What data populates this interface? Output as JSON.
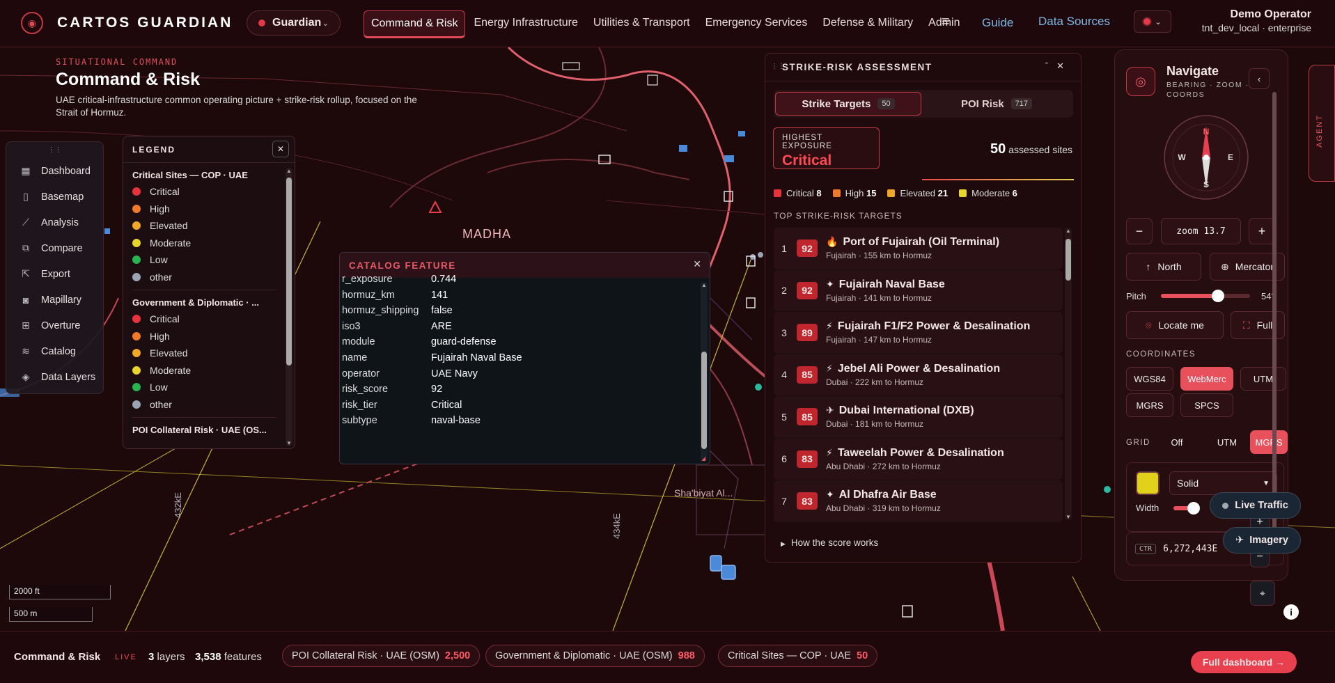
{
  "app": {
    "brand": "CARTOS GUARDIAN",
    "role": "Guardian"
  },
  "nav": {
    "items": [
      "Command & Risk",
      "Energy Infrastructure",
      "Utilities & Transport",
      "Emergency Services",
      "Defense & Military",
      "Admin"
    ],
    "guide": "Guide",
    "data_sources": "Data Sources"
  },
  "user": {
    "name": "Demo Operator",
    "sub": "tnt_dev_local · enterprise"
  },
  "page": {
    "kicker": "SITUATIONAL COMMAND",
    "title": "Command & Risk",
    "desc": "UAE critical-infrastructure common operating picture + strike-risk rollup, focused on the Strait of Hormuz."
  },
  "toolbox": {
    "items": [
      {
        "label": "Dashboard",
        "icon": "grid-icon"
      },
      {
        "label": "Basemap",
        "icon": "map-icon"
      },
      {
        "label": "Analysis",
        "icon": "chart-icon"
      },
      {
        "label": "Compare",
        "icon": "compare-icon"
      },
      {
        "label": "Export",
        "icon": "export-icon"
      },
      {
        "label": "Mapillary",
        "icon": "camera-icon"
      },
      {
        "label": "Overture",
        "icon": "table-icon"
      },
      {
        "label": "Catalog",
        "icon": "layers-icon"
      },
      {
        "label": "Data Layers",
        "icon": "stack-icon"
      }
    ]
  },
  "legend": {
    "title": "LEGEND",
    "sections": [
      {
        "title": "Critical Sites — COP · UAE",
        "rows": [
          {
            "label": "Critical",
            "color": "#e8323c"
          },
          {
            "label": "High",
            "color": "#f07a2a"
          },
          {
            "label": "Elevated",
            "color": "#f0a628"
          },
          {
            "label": "Moderate",
            "color": "#e8d42a"
          },
          {
            "label": "Low",
            "color": "#28b450"
          },
          {
            "label": "other",
            "color": "#9aa4b4"
          }
        ]
      },
      {
        "title": "Government & Diplomatic · ...",
        "rows": [
          {
            "label": "Critical",
            "color": "#e8323c"
          },
          {
            "label": "High",
            "color": "#f07a2a"
          },
          {
            "label": "Elevated",
            "color": "#f0a628"
          },
          {
            "label": "Moderate",
            "color": "#e8d42a"
          },
          {
            "label": "Low",
            "color": "#28b450"
          },
          {
            "label": "other",
            "color": "#9aa4b4"
          }
        ]
      },
      {
        "title": "POI Collateral Risk · UAE (OS...",
        "rows": []
      }
    ]
  },
  "catalog": {
    "title": "CATALOG FEATURE",
    "rows": [
      {
        "k": "r_exposure",
        "v": "0.744"
      },
      {
        "k": "hormuz_km",
        "v": "141"
      },
      {
        "k": "hormuz_shipping",
        "v": "false"
      },
      {
        "k": "iso3",
        "v": "ARE"
      },
      {
        "k": "module",
        "v": "guard-defense"
      },
      {
        "k": "name",
        "v": "Fujairah Naval Base"
      },
      {
        "k": "operator",
        "v": "UAE Navy"
      },
      {
        "k": "risk_score",
        "v": "92"
      },
      {
        "k": "risk_tier",
        "v": "Critical"
      },
      {
        "k": "subtype",
        "v": "naval-base"
      }
    ]
  },
  "strike": {
    "title": "STRIKE-RISK ASSESSMENT",
    "tab_targets": "Strike Targets",
    "tab_targets_count": "50",
    "tab_poi": "POI Risk",
    "tab_poi_count": "717",
    "highest_label": "HIGHEST EXPOSURE",
    "highest_value": "Critical",
    "assessed_count": "50",
    "assessed_label": "assessed sites",
    "tiers": [
      {
        "label": "Critical",
        "count": "8",
        "color": "#e8323c"
      },
      {
        "label": "High",
        "count": "15",
        "color": "#f07a2a"
      },
      {
        "label": "Elevated",
        "count": "21",
        "color": "#f0a628"
      },
      {
        "label": "Moderate",
        "count": "6",
        "color": "#e8d42a"
      }
    ],
    "top_label": "TOP STRIKE-RISK TARGETS",
    "targets": [
      {
        "rank": "1",
        "score": "92",
        "glyph": "🔥",
        "name": "Port of Fujairah (Oil Terminal)",
        "sub": "Fujairah · 155 km to Hormuz"
      },
      {
        "rank": "2",
        "score": "92",
        "glyph": "✦",
        "name": "Fujairah Naval Base",
        "sub": "Fujairah · 141 km to Hormuz"
      },
      {
        "rank": "3",
        "score": "89",
        "glyph": "⚡",
        "name": "Fujairah F1/F2 Power & Desalination",
        "sub": "Fujairah · 147 km to Hormuz"
      },
      {
        "rank": "4",
        "score": "85",
        "glyph": "⚡",
        "name": "Jebel Ali Power & Desalination",
        "sub": "Dubai · 222 km to Hormuz"
      },
      {
        "rank": "5",
        "score": "85",
        "glyph": "✈",
        "name": "Dubai International (DXB)",
        "sub": "Dubai · 181 km to Hormuz"
      },
      {
        "rank": "6",
        "score": "83",
        "glyph": "⚡",
        "name": "Taweelah Power & Desalination",
        "sub": "Abu Dhabi · 272 km to Hormuz"
      },
      {
        "rank": "7",
        "score": "83",
        "glyph": "✦",
        "name": "Al Dhafra Air Base",
        "sub": "Abu Dhabi · 319 km to Hormuz"
      }
    ],
    "how": "How the score works"
  },
  "navigate": {
    "title": "Navigate",
    "sub1": "BEARING · ZOOM ·",
    "sub2": "COORDS",
    "zoom": "zoom 13.7",
    "north": "North",
    "projection": "Mercator",
    "pitch_label": "Pitch",
    "pitch_value": "54°",
    "pitch_fraction": 0.64,
    "locate": "Locate me",
    "full": "Full",
    "coords_label": "COORDINATES",
    "coords": [
      "WGS84",
      "WebMerc",
      "UTM",
      "MGRS",
      "SPCS"
    ],
    "coords_selected": "WebMerc",
    "grid_label": "GRID",
    "grid": [
      "Off",
      "UTM",
      "MGRS"
    ],
    "grid_selected": "MGRS",
    "style": "Solid",
    "width_label": "Width",
    "swatch_color": "#e2d11a",
    "ctr_label": "CTR",
    "ctr_value": "6,272,443E",
    "agent": "AGENT",
    "compass": {
      "n": "N",
      "s": "S",
      "e": "E",
      "w": "W"
    }
  },
  "map": {
    "place": "MADHA",
    "place2": "Sha'biyat Al...",
    "grid1": "432kE",
    "grid2": "434kE",
    "scale_ft": "2000 ft",
    "scale_m": "500 m",
    "live_traffic": "Live Traffic",
    "imagery": "Imagery"
  },
  "footer": {
    "title": "Command & Risk",
    "live": "LIVE",
    "layers_n": "3",
    "layers_l": "layers",
    "features_n": "3,538",
    "features_l": "features",
    "chips": [
      {
        "label": "POI Collateral Risk · UAE (OSM)",
        "count": "2,500"
      },
      {
        "label": "Government & Diplomatic · UAE (OSM)",
        "count": "988"
      },
      {
        "label": "Critical Sites — COP · UAE",
        "count": "50"
      }
    ],
    "full_dashboard": "Full dashboard →"
  }
}
